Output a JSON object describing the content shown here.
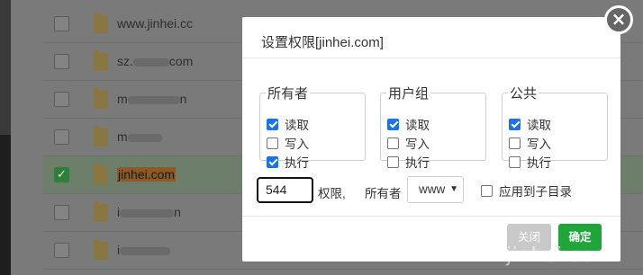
{
  "file_list": {
    "rows": [
      {
        "name": "www.jinhei.cc",
        "checked": false,
        "highlighted": false
      },
      {
        "name": "sz.",
        "name_tail": "com",
        "checked": false,
        "highlighted": false
      },
      {
        "name": "m",
        "name_tail": "n",
        "checked": false,
        "highlighted": false
      },
      {
        "name": "m",
        "name_tail": "",
        "checked": false,
        "highlighted": false
      },
      {
        "name": "jinhei.com",
        "checked": true,
        "highlighted": true
      },
      {
        "name": "i",
        "name_tail": "n",
        "checked": false,
        "highlighted": false
      },
      {
        "name": "i",
        "name_tail": "",
        "checked": false,
        "highlighted": false
      }
    ]
  },
  "dialog": {
    "title": "设置权限[jinhei.com]",
    "close_icon": "close-icon",
    "groups": [
      {
        "legend": "所有者",
        "perms": [
          {
            "label": "读取",
            "checked": true
          },
          {
            "label": "写入",
            "checked": false
          },
          {
            "label": "执行",
            "checked": true
          }
        ]
      },
      {
        "legend": "用户组",
        "perms": [
          {
            "label": "读取",
            "checked": true
          },
          {
            "label": "写入",
            "checked": false
          },
          {
            "label": "执行",
            "checked": false
          }
        ]
      },
      {
        "legend": "公共",
        "perms": [
          {
            "label": "读取",
            "checked": true
          },
          {
            "label": "写入",
            "checked": false
          },
          {
            "label": "执行",
            "checked": false
          }
        ]
      }
    ],
    "permission_value": "544",
    "permission_label": "权限,",
    "owner_label": "所有者",
    "owner_value": "www",
    "apply_subdirs_label": "应用到子目录",
    "apply_subdirs_checked": false,
    "btn_close_label": "关闭",
    "btn_ok_label": "确定"
  },
  "colors": {
    "accent": "#20a53a",
    "checkbox": "#1a73e8"
  },
  "watermark": "jinhei.com"
}
